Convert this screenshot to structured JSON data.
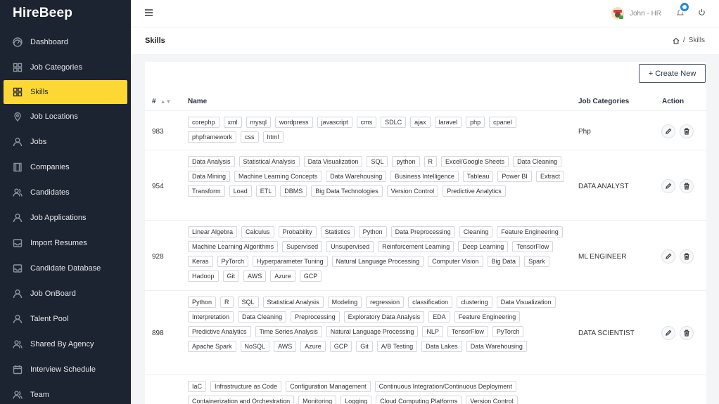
{
  "app": {
    "name": "HireBeep"
  },
  "sidebar": {
    "items": [
      {
        "label": "Dashboard",
        "icon": "dashboard-icon"
      },
      {
        "label": "Job Categories",
        "icon": "grid-icon"
      },
      {
        "label": "Skills",
        "icon": "grid-icon",
        "active": true
      },
      {
        "label": "Job Locations",
        "icon": "location-pin-icon"
      },
      {
        "label": "Jobs",
        "icon": "user-icon"
      },
      {
        "label": "Companies",
        "icon": "building-icon"
      },
      {
        "label": "Candidates",
        "icon": "users-icon"
      },
      {
        "label": "Job Applications",
        "icon": "user-icon"
      },
      {
        "label": "Import Resumes",
        "icon": "inbox-icon"
      },
      {
        "label": "Candidate Database",
        "icon": "inbox-icon"
      },
      {
        "label": "Job OnBoard",
        "icon": "user-icon"
      },
      {
        "label": "Talent Pool",
        "icon": "user-icon"
      },
      {
        "label": "Shared By Agency",
        "icon": "users-icon"
      },
      {
        "label": "Interview Schedule",
        "icon": "calendar-icon"
      },
      {
        "label": "Team",
        "icon": "users-icon"
      }
    ]
  },
  "header": {
    "user_name": "John - HR"
  },
  "page": {
    "title": "Skills",
    "breadcrumb": {
      "current": "Skills",
      "separator": "/"
    },
    "create_label": "+ Create New"
  },
  "table": {
    "columns": {
      "id": "#",
      "name": "Name",
      "category": "Job Categories",
      "action": "Action"
    },
    "rows": [
      {
        "id": "983",
        "category": "Php",
        "skills": [
          "corephp",
          "xml",
          "mysql",
          "wordpress",
          "javascript",
          "cms",
          "SDLC",
          "ajax",
          "laravel",
          "php",
          "cpanel",
          "phpframework",
          "css",
          "html"
        ]
      },
      {
        "id": "954",
        "category": "DATA ANALYST",
        "skills": [
          "Data Analysis",
          "Statistical Analysis",
          "Data Visualization",
          "SQL",
          "python",
          "R",
          "Excel/Google Sheets",
          "Data Cleaning",
          "Data Mining",
          "Machine Learning Concepts",
          "Data Warehousing",
          "Business Intelligence",
          "Tableau",
          "Power BI",
          "Extract",
          "Transform",
          "Load",
          "ETL",
          "DBMS",
          "Big Data Technologies",
          "Version Control",
          "Predictive Analytics"
        ]
      },
      {
        "id": "928",
        "category": "ML ENGINEER",
        "skills": [
          "Linear Algebra",
          "Calculus",
          "Probability",
          "Statistics",
          "Python",
          "Data Preprocessing",
          "Cleaning",
          "Feature Engineering",
          "Machine Learning Algorithms",
          "Supervised",
          "Unsupervised",
          "Reinforcement Learning",
          "Deep Learning",
          "TensorFlow",
          "Keras",
          "PyTorch",
          "Hyperparameter Tuning",
          "Natural Language Processing",
          "Computer Vision",
          "Big Data",
          "Spark",
          "Hadoop",
          "Git",
          "AWS",
          "Azure",
          "GCP"
        ]
      },
      {
        "id": "898",
        "category": "DATA SCIENTIST",
        "skills": [
          "Python",
          "R",
          "SQL",
          "Statistical Analysis",
          "Modeling",
          "regression",
          "classification",
          "clustering",
          "Data Visualization",
          "Interpretation",
          "Data Cleaning",
          "Preprocessing",
          "Exploratory Data Analysis",
          "EDA",
          "Feature Engineering",
          "Predictive Analytics",
          "Time Series Analysis",
          "Natural Language Processing",
          "NLP",
          "TensorFlow",
          "PyTorch",
          "Apache Spark",
          "NoSQL",
          "AWS",
          "Azure",
          "GCP",
          "Git",
          "A/B Testing",
          "Data Lakes",
          "Data Warehousing"
        ]
      },
      {
        "id": "",
        "category": "",
        "skills": [
          "IaC",
          "Infrastructure as Code",
          "Configuration Management",
          "Continuous Integration/Continuous Deployment",
          "Containerization and Orchestration",
          "Monitoring",
          "Logging",
          "Cloud Computing Platforms",
          "Version Control"
        ]
      }
    ]
  }
}
